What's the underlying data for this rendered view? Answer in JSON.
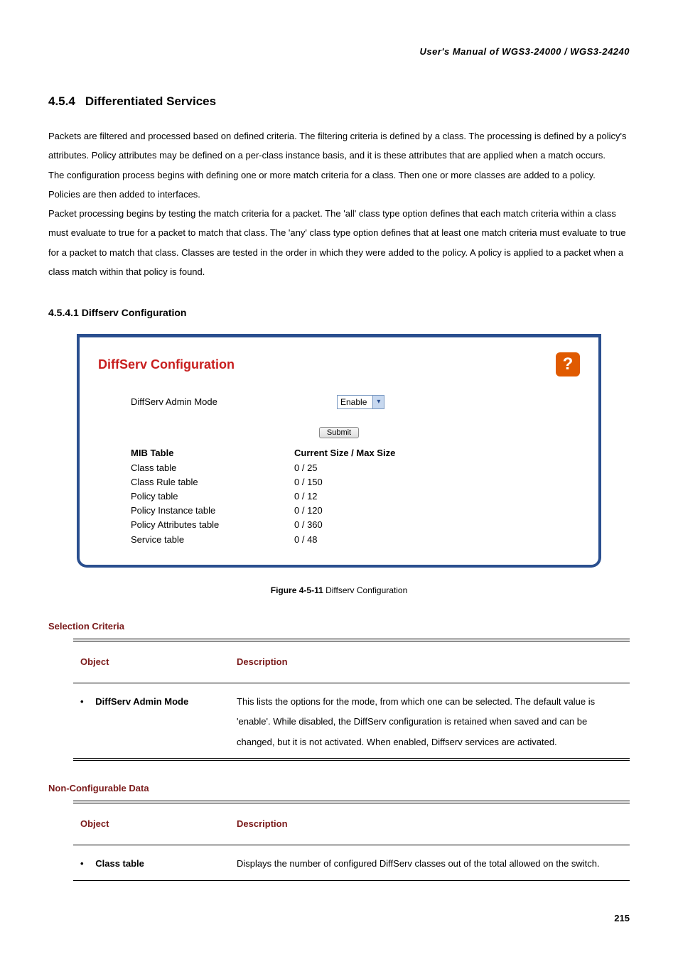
{
  "header": "User's  Manual  of  WGS3-24000  /  WGS3-24240",
  "section_number": "4.5.4",
  "section_title": "Differentiated Services",
  "paragraphs": [
    "Packets are filtered and processed based on defined criteria. The filtering criteria is defined by a class. The processing is defined by a policy's attributes. Policy attributes may be defined on a per-class instance basis, and it is these attributes that are applied when a match occurs.",
    "The configuration process begins with defining one or more match criteria for a class. Then one or more classes are added to a policy. Policies are then added to interfaces.",
    "Packet processing begins by testing the match criteria for a packet. The 'all' class type option defines that each match criteria within a class must evaluate to true for a packet to match that class. The 'any' class type option defines that at least one match criteria must evaluate to true for a packet to match that class. Classes are tested in the order in which they were added to the policy. A policy is applied to a packet when a class match within that policy is found."
  ],
  "subsection_title": "4.5.4.1 Diffserv Configuration",
  "panel": {
    "title": "DiffServ Configuration",
    "help_icon": "help-icon",
    "admin_mode_label": "DiffServ Admin Mode",
    "admin_mode_value": "Enable",
    "submit_label": "Submit",
    "mib_header_left": "MIB Table",
    "mib_header_right": "Current Size / Max Size",
    "mib_rows": [
      {
        "name": "Class table",
        "value": "0 / 25"
      },
      {
        "name": "Class Rule table",
        "value": "0 / 150"
      },
      {
        "name": "Policy table",
        "value": "0 / 12"
      },
      {
        "name": "Policy Instance table",
        "value": "0 / 120"
      },
      {
        "name": "Policy Attributes table",
        "value": "0 / 360"
      },
      {
        "name": "Service table",
        "value": "0 / 48"
      }
    ]
  },
  "figure_caption_bold": "Figure 4-5-11",
  "figure_caption_rest": " Diffserv Configuration",
  "selection_criteria_label": "Selection Criteria",
  "table1": {
    "col1": "Object",
    "col2": "Description",
    "rows": [
      {
        "object": "DiffServ Admin Mode",
        "description": "This lists the options for the mode, from which one can be selected. The default value is 'enable'. While disabled, the DiffServ configuration is retained when saved and can be changed, but it is not activated. When enabled, Diffserv services are activated."
      }
    ]
  },
  "nonconfig_label": "Non-Configurable Data",
  "table2": {
    "col1": "Object",
    "col2": "Description",
    "rows": [
      {
        "object": "Class table",
        "description": "Displays the number of configured DiffServ classes out of the total allowed on the switch."
      }
    ]
  },
  "page_number": "215"
}
